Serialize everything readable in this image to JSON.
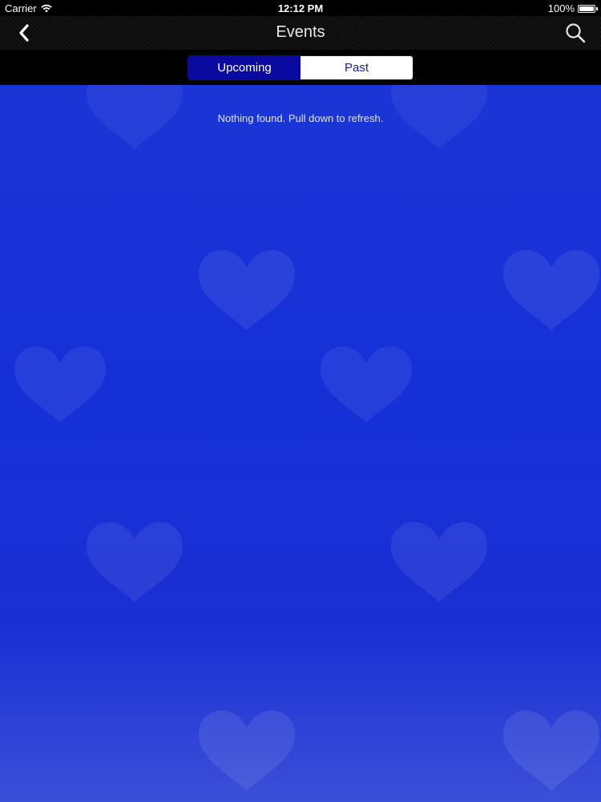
{
  "status_bar": {
    "carrier": "Carrier",
    "time": "12:12 PM",
    "battery_percent": "100%",
    "battery_level": 1.0,
    "icons": [
      "wifi-icon",
      "battery-icon"
    ]
  },
  "nav": {
    "title": "Events",
    "back_icon": "chevron-left-icon",
    "search_icon": "search-icon"
  },
  "segments": {
    "items": [
      {
        "label": "Upcoming",
        "selected": true
      },
      {
        "label": "Past",
        "selected": false
      }
    ]
  },
  "content": {
    "empty_message": "Nothing found. Pull down to refresh.",
    "background_pattern": "heart-icon"
  },
  "colors": {
    "background_blue": "#1630d8",
    "segment_selected": "#0a0aa0",
    "segment_text_unselected": "#1a1aa8"
  }
}
